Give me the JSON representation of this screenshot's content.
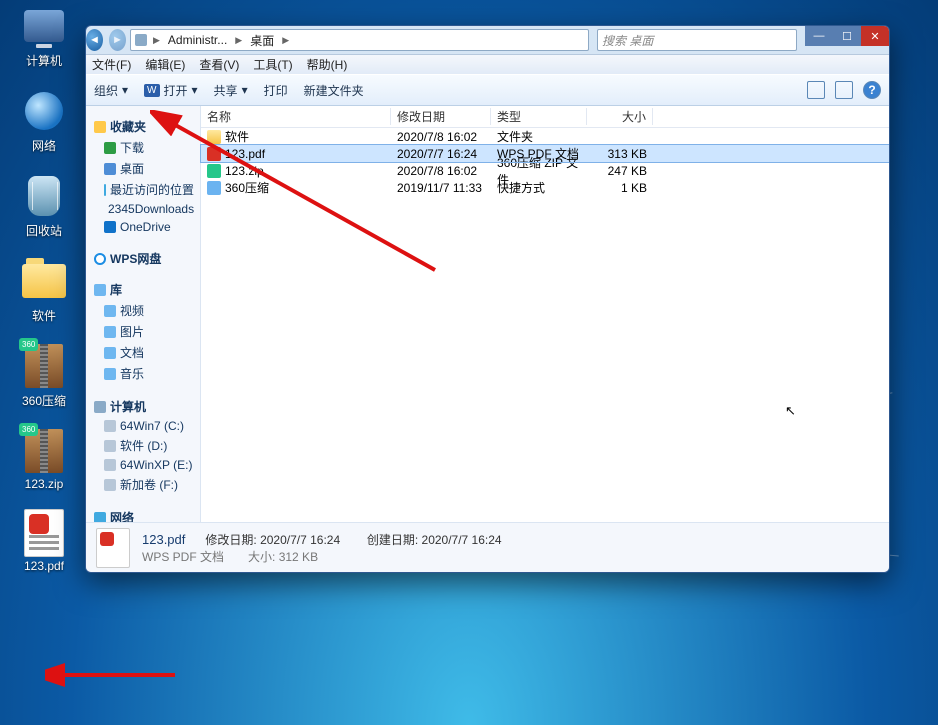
{
  "desktop_icons": [
    {
      "id": "computer",
      "label": "计算机"
    },
    {
      "id": "network",
      "label": "网络"
    },
    {
      "id": "recycle",
      "label": "回收站"
    },
    {
      "id": "software",
      "label": "软件"
    },
    {
      "id": "360zip",
      "label": "360压缩"
    },
    {
      "id": "123zip",
      "label": "123.zip"
    },
    {
      "id": "123pdf",
      "label": "123.pdf"
    }
  ],
  "window": {
    "breadcrumb": {
      "b1": "Administr...",
      "b2": "桌面"
    },
    "search_placeholder": "搜索 桌面",
    "menu": {
      "file": "文件(F)",
      "edit": "编辑(E)",
      "view": "查看(V)",
      "tools": "工具(T)",
      "help": "帮助(H)"
    },
    "toolbar": {
      "org": "组织",
      "open": "打开",
      "share": "共享",
      "print": "打印",
      "newfolder": "新建文件夹"
    },
    "columns": {
      "name": "名称",
      "date": "修改日期",
      "type": "类型",
      "size": "大小"
    },
    "sidebar": {
      "fav": "收藏夹",
      "fav_items": [
        "下载",
        "桌面",
        "最近访问的位置",
        "2345Downloads",
        "OneDrive"
      ],
      "wps": "WPS网盘",
      "lib": "库",
      "lib_items": [
        "视频",
        "图片",
        "文档",
        "音乐"
      ],
      "comp": "计算机",
      "drives": [
        "64Win7  (C:)",
        "软件 (D:)",
        "64WinXP  (E:)",
        "新加卷 (F:)"
      ],
      "net": "网络"
    },
    "files": [
      {
        "name": "软件",
        "date": "2020/7/8 16:02",
        "type": "文件夹",
        "size": "",
        "icon": "folder"
      },
      {
        "name": "123.pdf",
        "date": "2020/7/7 16:24",
        "type": "WPS PDF 文档",
        "size": "313 KB",
        "icon": "pdf",
        "selected": true
      },
      {
        "name": "123.zip",
        "date": "2020/7/8 16:02",
        "type": "360压缩 ZIP 文件",
        "size": "247 KB",
        "icon": "zip"
      },
      {
        "name": "360压缩",
        "date": "2019/11/7 11:33",
        "type": "快捷方式",
        "size": "1 KB",
        "icon": "link"
      }
    ],
    "details": {
      "name": "123.pdf",
      "type": "WPS PDF 文档",
      "mod_label": "修改日期:",
      "mod": "2020/7/7 16:24",
      "create_label": "创建日期:",
      "create": "2020/7/7 16:24",
      "size_label": "大小:",
      "size": "312 KB"
    }
  }
}
